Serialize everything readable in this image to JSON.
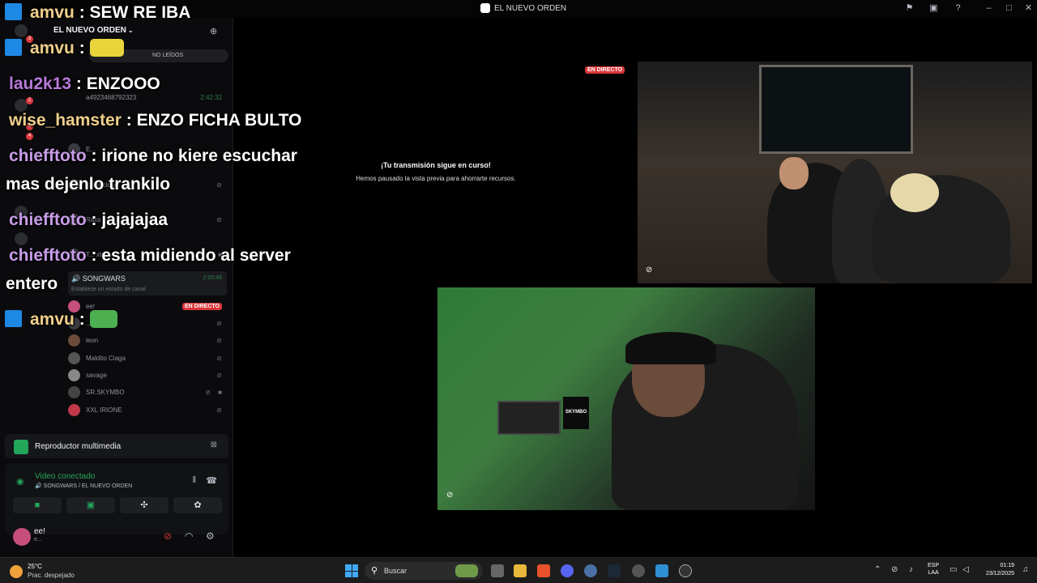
{
  "window": {
    "title": "EL NUEVO ORDEN"
  },
  "sidebar": {
    "server_name": "EL NUEVO ORDEN",
    "unread_pill": "NO LEÍDOS",
    "rail_badges": [
      "3",
      "2",
      "2",
      "4"
    ],
    "rows": [
      {
        "label": "a4923468792323",
        "time": "2:42:32"
      },
      {
        "label": "E..."
      },
      {
        "label": "lonelycloud"
      },
      {
        "label": "Raxs"
      },
      {
        "label": "T... xtc"
      }
    ],
    "voice_channel": {
      "name": "SONGWARS",
      "time": "2:00:46",
      "status": "Establece un estado de canal"
    },
    "voice_members": [
      {
        "name": "ee!",
        "live": "EN DIRECTO"
      },
      {
        "name": "...d"
      },
      {
        "name": "leon"
      },
      {
        "name": "Maldito Ciaga"
      },
      {
        "name": "savage"
      },
      {
        "name": "SR.SKYMBO"
      },
      {
        "name": "XXL IRIONE"
      }
    ],
    "media_player": {
      "label": "Reproductor multimedia"
    },
    "voice_panel": {
      "status": "Video conectado",
      "location": "SONGWARS / EL NUEVO ORDEN"
    },
    "user": {
      "name": "ee!",
      "status": "e..."
    }
  },
  "chat": [
    {
      "user": "amvu",
      "user_color": "#f0cf8c",
      "text": "SEW RE IBA",
      "badge": true
    },
    {
      "user": "amvu",
      "user_color": "#f0cf8c",
      "text": "",
      "badge": true,
      "emote": true
    },
    {
      "user": "lau2k13",
      "user_color": "#b77ad8",
      "text": "ENZOOO"
    },
    {
      "user": "wise_hamster",
      "user_color": "#f0cf8c",
      "text": "ENZO FICHA BULTO"
    },
    {
      "user": "chiefftoto",
      "user_color": "#c79ce8",
      "text": "irione no kiere escuchar",
      "cont": "mas dejenlo trankilo"
    },
    {
      "user": "chiefftoto",
      "user_color": "#c79ce8",
      "text": "jajajajaa"
    },
    {
      "user": "chiefftoto",
      "user_color": "#c79ce8",
      "text": "esta midiendo al server",
      "cont": "entero"
    },
    {
      "user": "amvu",
      "user_color": "#f0cf8c",
      "text": "",
      "badge": true,
      "emote": true
    }
  ],
  "stage": {
    "live_tag": "EN DIRECTO",
    "paused_title": "¡Tu transmisión sigue en curso!",
    "paused_sub": "Hemos pausado la vista previa para ahorrarte recursos.",
    "monitor_label": "SKYMBO"
  },
  "taskbar": {
    "weather_temp": "25°C",
    "weather_desc": "Prac. despejado",
    "search_placeholder": "Buscar",
    "lang_top": "ESP",
    "lang_bottom": "LAA",
    "time": "01:19",
    "date": "23/12/2025"
  },
  "colors": {
    "live": "#da373c",
    "connected": "#23a55a",
    "discord_bg": "#0b0b0d"
  }
}
